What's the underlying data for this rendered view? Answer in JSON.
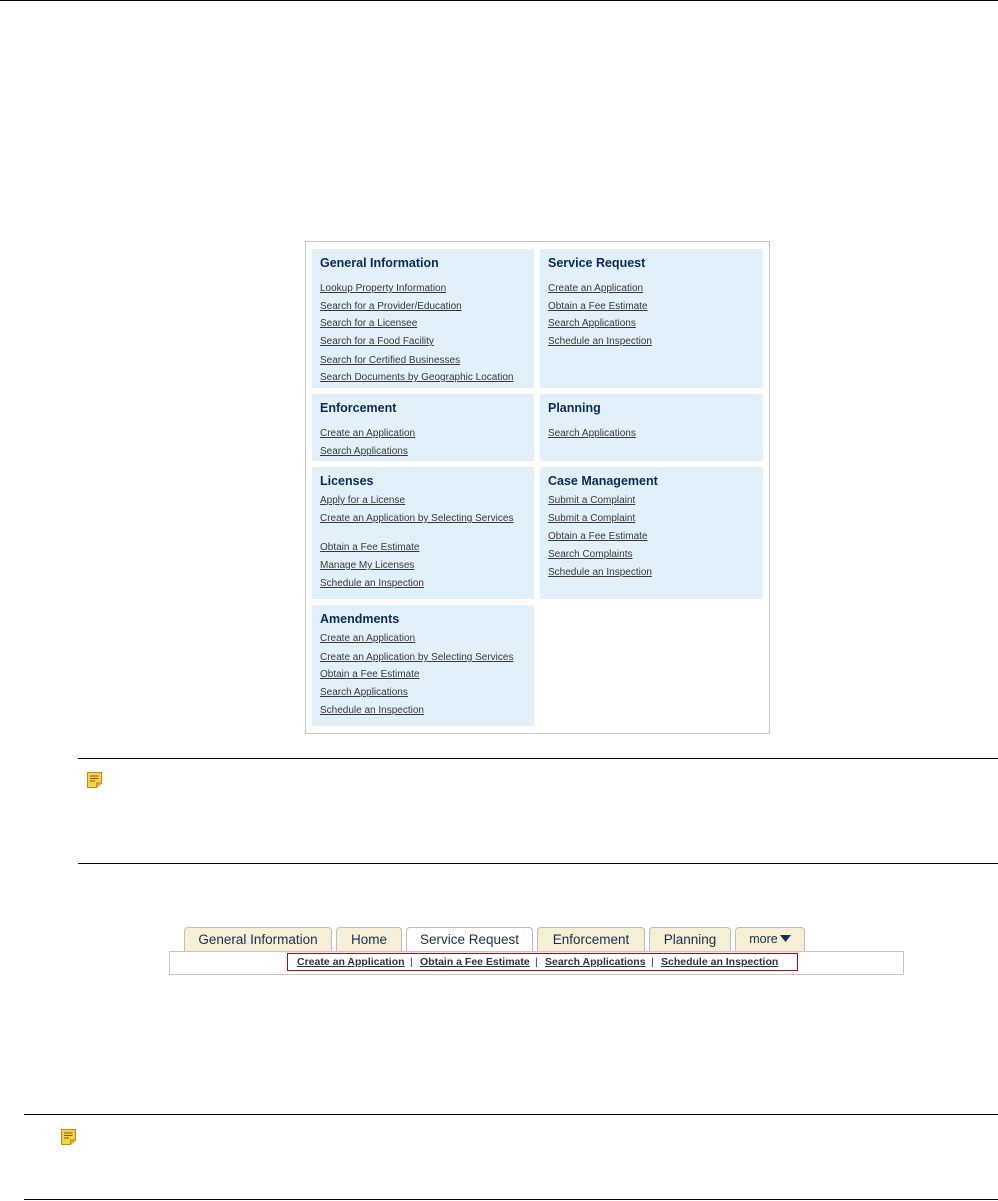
{
  "portal": {
    "general": {
      "title": "General Information",
      "links": [
        "Lookup Property Information",
        "Search for a Provider/Education",
        "Search for a Licensee",
        "Search for a Food Facility",
        "Search for Certified Businesses",
        "Search Documents by Geographic Location"
      ]
    },
    "service": {
      "title": "Service Request",
      "links": [
        "Create an Application",
        "Obtain a Fee Estimate",
        "Search Applications",
        "Schedule an Inspection"
      ]
    },
    "enforcement": {
      "title": "Enforcement",
      "links": [
        "Create an Application",
        "Search Applications"
      ]
    },
    "planning": {
      "title": "Planning",
      "links": [
        "Search Applications"
      ]
    },
    "licenses": {
      "title": "Licenses",
      "links": [
        "Apply for a License",
        "Create an Application by Selecting Services",
        "Obtain a Fee Estimate",
        "Manage My Licenses",
        "Schedule an Inspection"
      ]
    },
    "case": {
      "title": "Case Management",
      "links": [
        "Submit a Complaint",
        "Submit a Complaint",
        "Obtain a Fee Estimate",
        "Search Complaints",
        "Schedule an Inspection"
      ]
    },
    "amendments": {
      "title": "Amendments",
      "links": [
        "Create an Application",
        "Create an Application by Selecting Services",
        "Obtain a Fee Estimate",
        "Search Applications",
        "Schedule an Inspection"
      ]
    }
  },
  "tabs": [
    "General Information",
    "Home",
    "Service Request",
    "Enforcement",
    "Planning",
    "more"
  ],
  "active_tab": "Service Request",
  "subnav": {
    "links": [
      "Create an Application",
      "Obtain a Fee Estimate",
      "Search Applications",
      "Schedule an Inspection"
    ],
    "separator": "|"
  },
  "icons": {
    "note": "note-icon",
    "dropdown": "caret-down-icon"
  },
  "colors": {
    "card_bg": "#e2f0fa",
    "heading": "#0b2a5a",
    "tab_bg": "#f4efd5",
    "highlight": "#cc0000"
  }
}
